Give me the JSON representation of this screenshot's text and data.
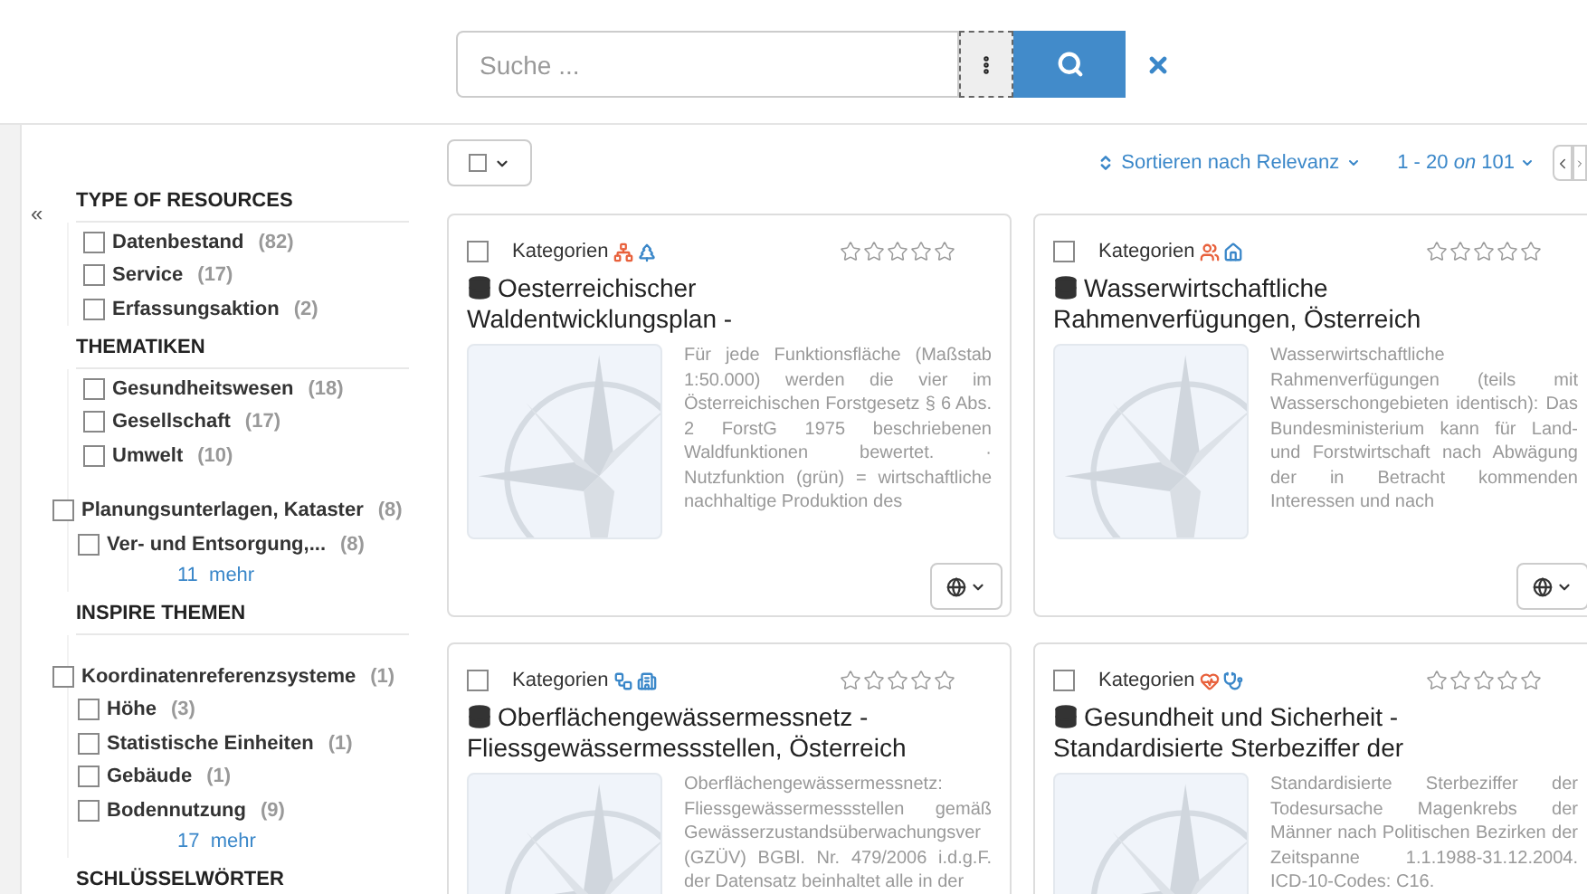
{
  "search": {
    "placeholder": "Suche ..."
  },
  "sidebar": {
    "collapse": "«",
    "groups": [
      {
        "title": "TYPE OF RESOURCES",
        "items": [
          {
            "label": "Datenbestand",
            "count": "(82)",
            "checked": false
          },
          {
            "label": "Service",
            "count": "(17)",
            "checked": false
          },
          {
            "label": "Erfassungsaktion",
            "count": "(2)",
            "checked": false
          }
        ]
      },
      {
        "title": "THEMATIKEN",
        "items": [
          {
            "label": "Gesundheitswesen",
            "count": "(18)",
            "checked": false
          },
          {
            "label": "Gesellschaft",
            "count": "(17)",
            "checked": false
          },
          {
            "label": "Umwelt",
            "count": "(10)",
            "checked": false
          },
          {
            "label": "Planungsunterlagen, Kataster",
            "count": "(8)",
            "checked": false,
            "children": [
              {
                "label": "Ver- und Entsorgung,...",
                "count": "(8)",
                "checked": false
              }
            ]
          }
        ],
        "more": "11  mehr"
      },
      {
        "title": "INSPIRE THEMEN",
        "items": [
          {
            "label": "Koordinatenreferenzsysteme",
            "count": "(1)",
            "checked": false,
            "children": [
              {
                "label": "Höhe",
                "count": "(3)",
                "checked": false
              },
              {
                "label": "Statistische Einheiten",
                "count": "(1)",
                "checked": false
              },
              {
                "label": "Gebäude",
                "count": "(1)",
                "checked": false
              },
              {
                "label": "Bodennutzung",
                "count": "(9)",
                "checked": false
              }
            ]
          }
        ],
        "more": "17  mehr"
      },
      {
        "title": "SCHLÜSSELWÖRTER"
      }
    ]
  },
  "toolbar": {
    "select_all_checked": false,
    "sort": "Sortieren nach Relevanz",
    "paging": {
      "range": "1 - 20",
      "on": "on",
      "total": "101"
    }
  },
  "results": [
    {
      "checked": false,
      "category_label": "Kategorien",
      "categories": [
        {
          "kind": "network",
          "color": "#e8613c"
        },
        {
          "kind": "tree",
          "color": "#3a87c9"
        }
      ],
      "stars": 0,
      "title": "Oesterreichischer Waldentwicklungsplan -",
      "description": "Für jede Funktionsfläche (Maßstab 1:50.000) werden die vier im Österreichischen Forstgesetz § 6 Abs. 2 ForstG 1975 beschriebenen Waldfunktionen bewertet. · Nutzfunktion (grün) = wirtschaftliche nachhaltige Produktion des"
    },
    {
      "checked": false,
      "category_label": "Kategorien",
      "categories": [
        {
          "kind": "people",
          "color": "#e8613c"
        },
        {
          "kind": "house",
          "color": "#3a87c9"
        }
      ],
      "stars": 0,
      "title": "Wasserwirtschaftliche Rahmenverfügungen, Österreich",
      "description": "Wasserwirtschaftliche Rahmenverfügungen (teils mit Wasserschongebieten identisch): Das Bundesministerium kann für Land- und Forstwirtschaft nach Abwägung der in Betracht kommenden Interessen und nach"
    },
    {
      "checked": false,
      "category_label": "Kategorien",
      "categories": [
        {
          "kind": "flow",
          "color": "#3a87c9"
        },
        {
          "kind": "building",
          "color": "#3a87c9"
        }
      ],
      "stars": 0,
      "title": "Oberflächengewässermessnetz - Fliessgewässermessstellen, Österreich",
      "description": "Oberflächengewässermessnetz: Fliessgewässermessstellen gemäß Gewässerzustandsüberwachungsver (GZÜV) BGBl. Nr. 479/2006 i.d.g.F. der Datensatz beinhaltet alle in der"
    },
    {
      "checked": false,
      "category_label": "Kategorien",
      "categories": [
        {
          "kind": "heart",
          "color": "#e8613c"
        },
        {
          "kind": "stethoscope",
          "color": "#3a87c9"
        }
      ],
      "stars": 0,
      "title": "Gesundheit und Sicherheit - Standardisierte Sterbeziffer der",
      "description": "Standardisierte Sterbeziffer der Todesursache Magenkrebs der Männer nach Politischen Bezirken der Zeitspanne 1.1.1988-31.12.2004. ICD-10-Codes: C16."
    }
  ]
}
